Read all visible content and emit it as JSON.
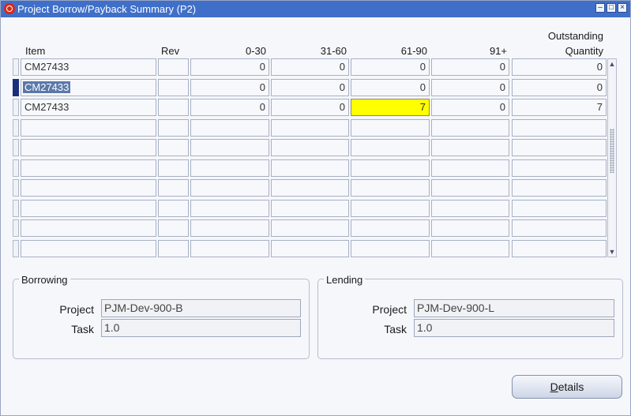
{
  "window": {
    "title": "Project Borrow/Payback Summary (P2)",
    "controls": [
      "minimize",
      "maximize",
      "close"
    ]
  },
  "table": {
    "headers": {
      "item": "Item",
      "rev": "Rev",
      "b0_30": "0-30",
      "b31_60": "31-60",
      "b61_90": "61-90",
      "b91": "91+",
      "outstanding_line1": "Outstanding",
      "outstanding_line2": "Quantity"
    },
    "rows": [
      {
        "item": "CM27433",
        "rev": "",
        "b0_30": "0",
        "b31_60": "0",
        "b61_90": "0",
        "b91": "0",
        "qty": "0"
      },
      {
        "item": "CM27433",
        "rev": "",
        "b0_30": "0",
        "b31_60": "0",
        "b61_90": "0",
        "b91": "0",
        "qty": "0"
      },
      {
        "item": "CM27433",
        "rev": "",
        "b0_30": "0",
        "b31_60": "0",
        "b61_90": "7",
        "b91": "0",
        "qty": "7"
      }
    ],
    "empty_rows": 7,
    "selected_row": 2,
    "highlight_color": "#ffff00"
  },
  "borrowing": {
    "title": "Borrowing",
    "project_label": "Project",
    "project_value": "PJM-Dev-900-B",
    "task_label": "Task",
    "task_value": "1.0"
  },
  "lending": {
    "title": "Lending",
    "project_label": "Project",
    "project_value": "PJM-Dev-900-L",
    "task_label": "Task",
    "task_value": "1.0"
  },
  "details_button": {
    "label_underlined": "D",
    "label_rest": "etails"
  },
  "colors": {
    "titlebar": "#3f6fc8",
    "selection": "#5b78a9",
    "active_row_marker": "#1b2f7a"
  }
}
